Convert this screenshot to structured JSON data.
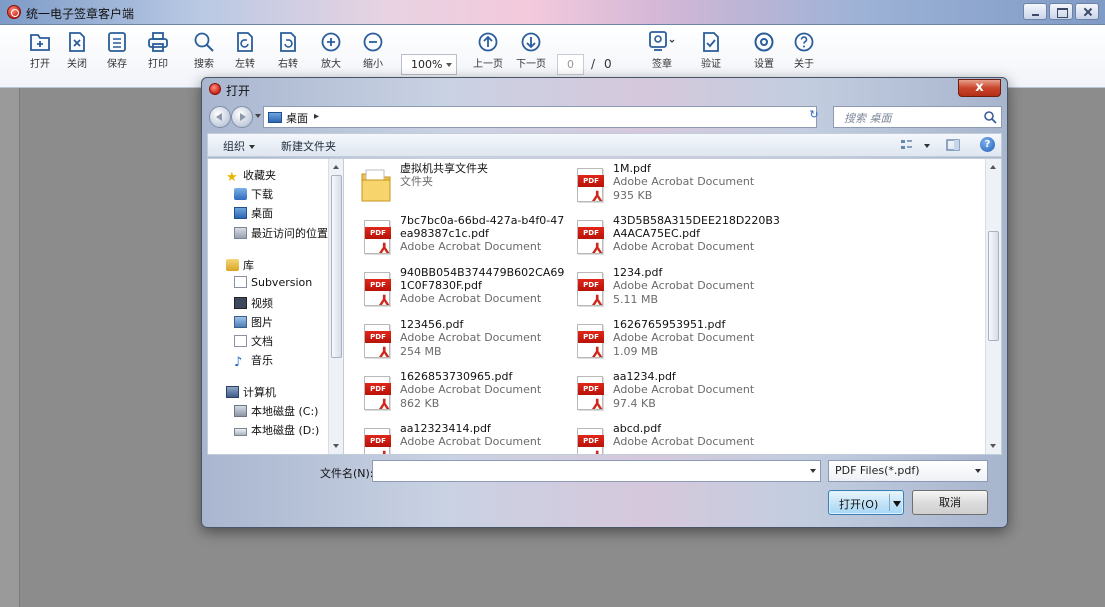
{
  "app": {
    "title": "统一电子签章客户端"
  },
  "toolbar": {
    "items": [
      {
        "label": "打开",
        "icon": "open-icon"
      },
      {
        "label": "关闭",
        "icon": "close-doc-icon"
      },
      {
        "label": "保存",
        "icon": "save-icon"
      },
      {
        "label": "打印",
        "icon": "print-icon"
      },
      {
        "label": "搜索",
        "icon": "search-icon"
      },
      {
        "label": "左转",
        "icon": "rotate-left-icon"
      },
      {
        "label": "右转",
        "icon": "rotate-right-icon"
      },
      {
        "label": "放大",
        "icon": "zoom-in-icon"
      },
      {
        "label": "缩小",
        "icon": "zoom-out-icon"
      },
      {
        "label": "上一页",
        "icon": "prev-page-icon"
      },
      {
        "label": "下一页",
        "icon": "next-page-icon"
      },
      {
        "label": "签章",
        "icon": "stamp-icon"
      },
      {
        "label": "验证",
        "icon": "verify-icon"
      },
      {
        "label": "设置",
        "icon": "settings-icon"
      },
      {
        "label": "关于",
        "icon": "about-icon"
      }
    ],
    "zoom": "100%",
    "page_current": "0",
    "page_separator": "/",
    "page_total": "0"
  },
  "dialog": {
    "title": "打开",
    "close_label": "x",
    "address": "桌面",
    "search_placeholder": "搜索 桌面",
    "commands": {
      "organize": "组织",
      "new_folder": "新建文件夹"
    },
    "nav": {
      "favorites": "收藏夹",
      "downloads": "下载",
      "desktop": "桌面",
      "recent": "最近访问的位置",
      "libraries": "库",
      "subversion": "Subversion",
      "videos": "视频",
      "pictures": "图片",
      "documents": "文档",
      "music": "音乐",
      "computer": "计算机",
      "drive_c": "本地磁盘 (C:)",
      "drive_d": "本地磁盘 (D:)"
    },
    "files": [
      {
        "name": "虚拟机共享文件夹",
        "type": "文件夹",
        "size": "",
        "kind": "folder"
      },
      {
        "name": "1M.pdf",
        "type": "Adobe Acrobat Document",
        "size": "935 KB",
        "kind": "pdf"
      },
      {
        "name": "7bc7bc0a-66bd-427a-b4f0-47ea98387c1c.pdf",
        "type": "Adobe Acrobat Document",
        "size": "",
        "kind": "pdf"
      },
      {
        "name": "43D5B58A315DEE218D220B3A4ACA75EC.pdf",
        "type": "Adobe Acrobat Document",
        "size": "",
        "kind": "pdf"
      },
      {
        "name": "940BB054B374479B602CA691C0F7830F.pdf",
        "type": "Adobe Acrobat Document",
        "size": "",
        "kind": "pdf"
      },
      {
        "name": "1234.pdf",
        "type": "Adobe Acrobat Document",
        "size": "5.11 MB",
        "kind": "pdf"
      },
      {
        "name": "123456.pdf",
        "type": "Adobe Acrobat Document",
        "size": "254 MB",
        "kind": "pdf"
      },
      {
        "name": "1626765953951.pdf",
        "type": "Adobe Acrobat Document",
        "size": "1.09 MB",
        "kind": "pdf"
      },
      {
        "name": "1626853730965.pdf",
        "type": "Adobe Acrobat Document",
        "size": "862 KB",
        "kind": "pdf"
      },
      {
        "name": "aa1234.pdf",
        "type": "Adobe Acrobat Document",
        "size": "97.4 KB",
        "kind": "pdf"
      },
      {
        "name": "aa12323414.pdf",
        "type": "Adobe Acrobat Document",
        "size": "",
        "kind": "pdf"
      },
      {
        "name": "abcd.pdf",
        "type": "Adobe Acrobat Document",
        "size": "",
        "kind": "pdf"
      }
    ],
    "filename_label": "文件名(N):",
    "filename_value": "",
    "filetype": "PDF Files(*.pdf)",
    "open_label": "打开(O)",
    "cancel_label": "取消"
  }
}
